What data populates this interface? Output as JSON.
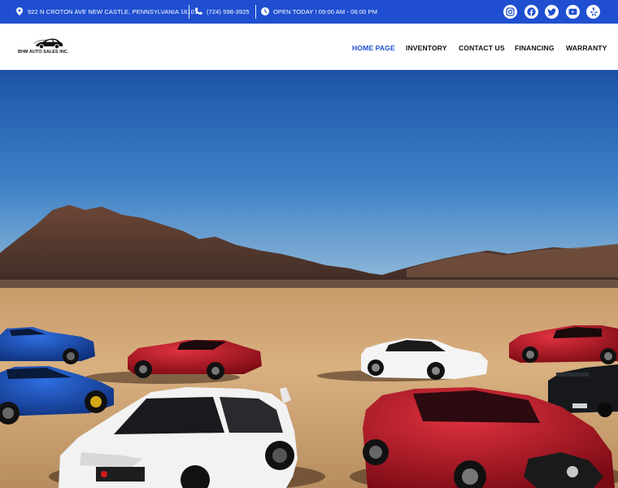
{
  "topbar": {
    "address": "922 N CROTON AVE NEW CASTLE, PENNSYLVANIA 16101",
    "phone": "(724) 598-3925",
    "hours": "OPEN TODAY ! 09:00 AM - 06:00 PM",
    "socials": [
      "instagram-icon",
      "facebook-icon",
      "twitter-icon",
      "youtube-icon",
      "yelp-icon"
    ]
  },
  "brand": {
    "name": "BHM AUTO SALES INC."
  },
  "nav": {
    "items": [
      {
        "label": "HOME PAGE",
        "active": true
      },
      {
        "label": "INVENTORY",
        "active": false
      },
      {
        "label": "CONTACT US",
        "active": false
      },
      {
        "label": "FINANCING",
        "active": false
      },
      {
        "label": "WARRANTY",
        "active": false
      }
    ]
  },
  "colors": {
    "accent": "#1f4fd0",
    "topbar_bg": "#1f4fd0",
    "text": "#111111"
  }
}
